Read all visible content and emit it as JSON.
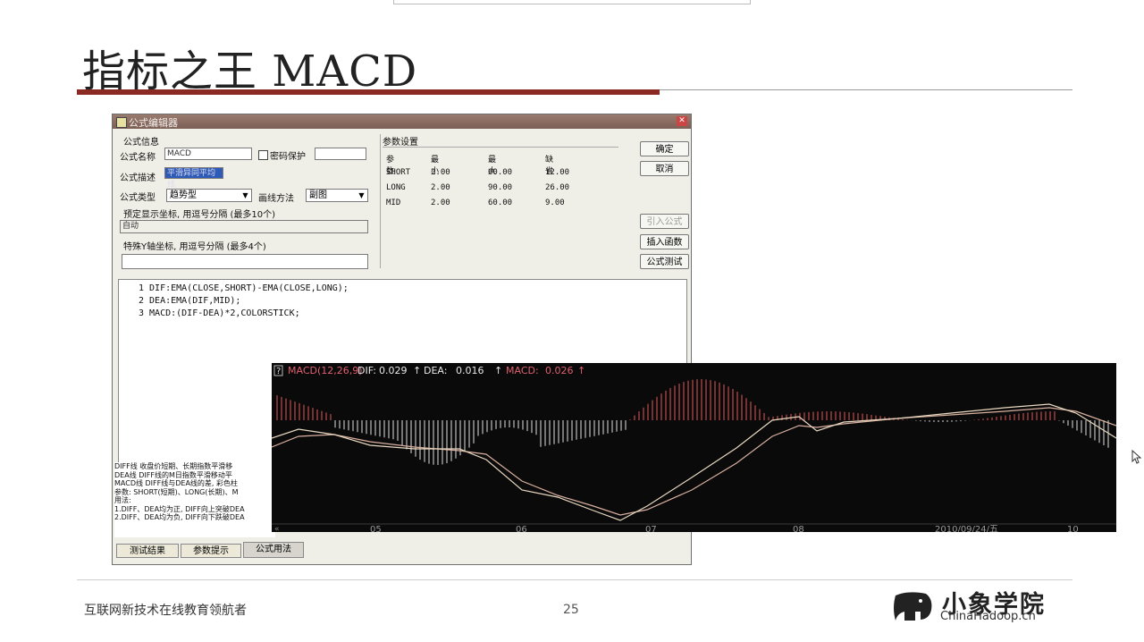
{
  "slide": {
    "title": "指标之王 MACD",
    "footer_text": "互联网新技术在线教育领航者",
    "page_number": "25",
    "logo_cn": "小象学院",
    "logo_en": "ChinaHadoop.cn",
    "accent_color": "#8a2a23"
  },
  "editor": {
    "window_title": "公式编辑器",
    "section_info": "公式信息",
    "name_label": "公式名称",
    "name_value": "MACD",
    "password_label": "密码保护",
    "desc_label": "公式描述",
    "desc_value": "平滑异同平均线",
    "type_label": "公式类型",
    "type_value": "趋势型",
    "draw_label": "画线方法",
    "draw_value": "副图",
    "coords_label": "预定显示坐标, 用逗号分隔 (最多10个)",
    "coords_value": "自动",
    "special_label": "特殊Y轴坐标, 用逗号分隔 (最多4个)",
    "special_value": "",
    "params_title": "参数设置",
    "params_headers": [
      "参数",
      "最小",
      "最大",
      "缺省"
    ],
    "params_rows": [
      [
        "SHORT",
        "2.00",
        "60.00",
        "12.00"
      ],
      [
        "LONG",
        "2.00",
        "90.00",
        "26.00"
      ],
      [
        "MID",
        "2.00",
        "60.00",
        "9.00"
      ]
    ],
    "buttons": {
      "ok": "确定",
      "cancel": "取消",
      "import": "引入公式",
      "insert_func": "插入函数",
      "test": "公式测试"
    },
    "code_lines": [
      "1 DIF:EMA(CLOSE,SHORT)-EMA(CLOSE,LONG);",
      "2 DEA:EMA(DIF,MID);",
      "3 MACD:(DIF-DEA)*2,COLORSTICK;"
    ],
    "help_lines": [
      "DIFF线  收盘价短期、长期指数平滑移",
      "DEA线   DIFF线的M日指数平滑移动平",
      "MACD线  DIFF线与DEA线的差, 彩色柱",
      "参数: SHORT(短期)、LONG(长期)、M",
      "用法:",
      "1.DIFF、DEA均为正, DIFF向上突破DEA",
      "2.DIFF、DEA均为负, DIFF向下跌破DEA"
    ],
    "tabs": [
      "测试结果",
      "参数提示",
      "公式用法"
    ]
  },
  "macd_chart": {
    "indicator": "MACD(12,26,9)",
    "dif_label": "DIF:",
    "dif_value": "0.029",
    "dea_label": "DEA:",
    "dea_value": "0.016",
    "macd_label": "MACD:",
    "macd_value": "0.026",
    "x_ticks": [
      "05",
      "06",
      "07",
      "08",
      "2010/09/24/五",
      "10"
    ],
    "colors": {
      "dif": "#e8d8c0",
      "dea": "#d8b0a0",
      "pos_bar": "#e05a5a",
      "neg_bar": "#e0e0e0",
      "label": "#e06070"
    }
  }
}
